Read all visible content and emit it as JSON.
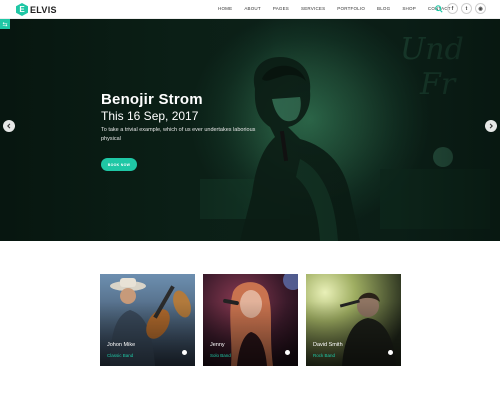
{
  "brand": {
    "logo_letter": "E",
    "name": "ELVIS"
  },
  "nav": {
    "items": [
      "HOME",
      "ABOUT",
      "PAGES",
      "SERVICES",
      "PORTFOLIO",
      "BLOG",
      "SHOP",
      "CONTACT"
    ]
  },
  "social": {
    "icons": [
      "search-icon",
      "facebook-icon",
      "twitter-icon",
      "dribbble-icon"
    ],
    "labels": [
      "f",
      "t",
      "◉"
    ]
  },
  "hero": {
    "title": "Benojir Strom",
    "date": "This 16 Sep, 2017",
    "description": "To take a trivial example, which of us ever undertakes laborious physical",
    "button": "BOOK NOW",
    "prev": "‹",
    "next": "›"
  },
  "cards": [
    {
      "name": "Johon Mike",
      "genre": "Classic Band"
    },
    {
      "name": "Jenny",
      "genre": "Solo Band"
    },
    {
      "name": "David Smith",
      "genre": "Rock Band"
    }
  ],
  "colors": {
    "accent": "#1fc7a5",
    "hero_tint": "#1f4a35"
  }
}
